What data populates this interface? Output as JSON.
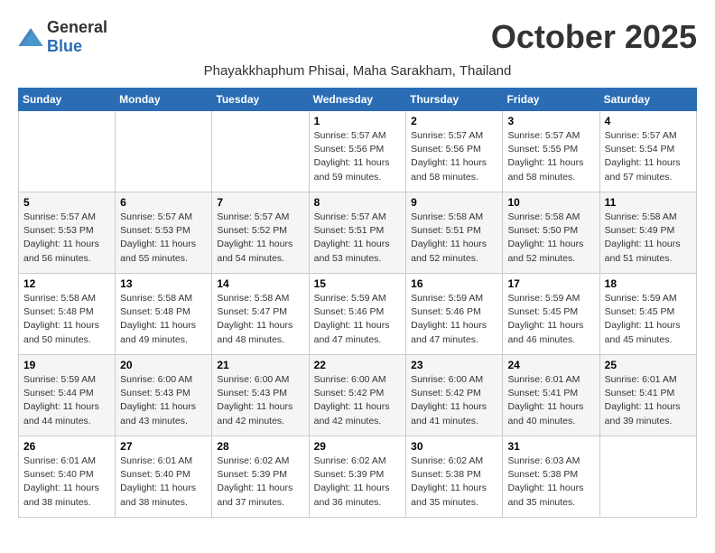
{
  "header": {
    "logo_general": "General",
    "logo_blue": "Blue",
    "month_title": "October 2025",
    "subtitle": "Phayakkhaphum Phisai, Maha Sarakham, Thailand"
  },
  "days_of_week": [
    "Sunday",
    "Monday",
    "Tuesday",
    "Wednesday",
    "Thursday",
    "Friday",
    "Saturday"
  ],
  "weeks": [
    [
      {
        "day": "",
        "sunrise": "",
        "sunset": "",
        "daylight": ""
      },
      {
        "day": "",
        "sunrise": "",
        "sunset": "",
        "daylight": ""
      },
      {
        "day": "",
        "sunrise": "",
        "sunset": "",
        "daylight": ""
      },
      {
        "day": "1",
        "sunrise": "Sunrise: 5:57 AM",
        "sunset": "Sunset: 5:56 PM",
        "daylight": "Daylight: 11 hours and 59 minutes."
      },
      {
        "day": "2",
        "sunrise": "Sunrise: 5:57 AM",
        "sunset": "Sunset: 5:56 PM",
        "daylight": "Daylight: 11 hours and 58 minutes."
      },
      {
        "day": "3",
        "sunrise": "Sunrise: 5:57 AM",
        "sunset": "Sunset: 5:55 PM",
        "daylight": "Daylight: 11 hours and 58 minutes."
      },
      {
        "day": "4",
        "sunrise": "Sunrise: 5:57 AM",
        "sunset": "Sunset: 5:54 PM",
        "daylight": "Daylight: 11 hours and 57 minutes."
      }
    ],
    [
      {
        "day": "5",
        "sunrise": "Sunrise: 5:57 AM",
        "sunset": "Sunset: 5:53 PM",
        "daylight": "Daylight: 11 hours and 56 minutes."
      },
      {
        "day": "6",
        "sunrise": "Sunrise: 5:57 AM",
        "sunset": "Sunset: 5:53 PM",
        "daylight": "Daylight: 11 hours and 55 minutes."
      },
      {
        "day": "7",
        "sunrise": "Sunrise: 5:57 AM",
        "sunset": "Sunset: 5:52 PM",
        "daylight": "Daylight: 11 hours and 54 minutes."
      },
      {
        "day": "8",
        "sunrise": "Sunrise: 5:57 AM",
        "sunset": "Sunset: 5:51 PM",
        "daylight": "Daylight: 11 hours and 53 minutes."
      },
      {
        "day": "9",
        "sunrise": "Sunrise: 5:58 AM",
        "sunset": "Sunset: 5:51 PM",
        "daylight": "Daylight: 11 hours and 52 minutes."
      },
      {
        "day": "10",
        "sunrise": "Sunrise: 5:58 AM",
        "sunset": "Sunset: 5:50 PM",
        "daylight": "Daylight: 11 hours and 52 minutes."
      },
      {
        "day": "11",
        "sunrise": "Sunrise: 5:58 AM",
        "sunset": "Sunset: 5:49 PM",
        "daylight": "Daylight: 11 hours and 51 minutes."
      }
    ],
    [
      {
        "day": "12",
        "sunrise": "Sunrise: 5:58 AM",
        "sunset": "Sunset: 5:48 PM",
        "daylight": "Daylight: 11 hours and 50 minutes."
      },
      {
        "day": "13",
        "sunrise": "Sunrise: 5:58 AM",
        "sunset": "Sunset: 5:48 PM",
        "daylight": "Daylight: 11 hours and 49 minutes."
      },
      {
        "day": "14",
        "sunrise": "Sunrise: 5:58 AM",
        "sunset": "Sunset: 5:47 PM",
        "daylight": "Daylight: 11 hours and 48 minutes."
      },
      {
        "day": "15",
        "sunrise": "Sunrise: 5:59 AM",
        "sunset": "Sunset: 5:46 PM",
        "daylight": "Daylight: 11 hours and 47 minutes."
      },
      {
        "day": "16",
        "sunrise": "Sunrise: 5:59 AM",
        "sunset": "Sunset: 5:46 PM",
        "daylight": "Daylight: 11 hours and 47 minutes."
      },
      {
        "day": "17",
        "sunrise": "Sunrise: 5:59 AM",
        "sunset": "Sunset: 5:45 PM",
        "daylight": "Daylight: 11 hours and 46 minutes."
      },
      {
        "day": "18",
        "sunrise": "Sunrise: 5:59 AM",
        "sunset": "Sunset: 5:45 PM",
        "daylight": "Daylight: 11 hours and 45 minutes."
      }
    ],
    [
      {
        "day": "19",
        "sunrise": "Sunrise: 5:59 AM",
        "sunset": "Sunset: 5:44 PM",
        "daylight": "Daylight: 11 hours and 44 minutes."
      },
      {
        "day": "20",
        "sunrise": "Sunrise: 6:00 AM",
        "sunset": "Sunset: 5:43 PM",
        "daylight": "Daylight: 11 hours and 43 minutes."
      },
      {
        "day": "21",
        "sunrise": "Sunrise: 6:00 AM",
        "sunset": "Sunset: 5:43 PM",
        "daylight": "Daylight: 11 hours and 42 minutes."
      },
      {
        "day": "22",
        "sunrise": "Sunrise: 6:00 AM",
        "sunset": "Sunset: 5:42 PM",
        "daylight": "Daylight: 11 hours and 42 minutes."
      },
      {
        "day": "23",
        "sunrise": "Sunrise: 6:00 AM",
        "sunset": "Sunset: 5:42 PM",
        "daylight": "Daylight: 11 hours and 41 minutes."
      },
      {
        "day": "24",
        "sunrise": "Sunrise: 6:01 AM",
        "sunset": "Sunset: 5:41 PM",
        "daylight": "Daylight: 11 hours and 40 minutes."
      },
      {
        "day": "25",
        "sunrise": "Sunrise: 6:01 AM",
        "sunset": "Sunset: 5:41 PM",
        "daylight": "Daylight: 11 hours and 39 minutes."
      }
    ],
    [
      {
        "day": "26",
        "sunrise": "Sunrise: 6:01 AM",
        "sunset": "Sunset: 5:40 PM",
        "daylight": "Daylight: 11 hours and 38 minutes."
      },
      {
        "day": "27",
        "sunrise": "Sunrise: 6:01 AM",
        "sunset": "Sunset: 5:40 PM",
        "daylight": "Daylight: 11 hours and 38 minutes."
      },
      {
        "day": "28",
        "sunrise": "Sunrise: 6:02 AM",
        "sunset": "Sunset: 5:39 PM",
        "daylight": "Daylight: 11 hours and 37 minutes."
      },
      {
        "day": "29",
        "sunrise": "Sunrise: 6:02 AM",
        "sunset": "Sunset: 5:39 PM",
        "daylight": "Daylight: 11 hours and 36 minutes."
      },
      {
        "day": "30",
        "sunrise": "Sunrise: 6:02 AM",
        "sunset": "Sunset: 5:38 PM",
        "daylight": "Daylight: 11 hours and 35 minutes."
      },
      {
        "day": "31",
        "sunrise": "Sunrise: 6:03 AM",
        "sunset": "Sunset: 5:38 PM",
        "daylight": "Daylight: 11 hours and 35 minutes."
      },
      {
        "day": "",
        "sunrise": "",
        "sunset": "",
        "daylight": ""
      }
    ]
  ]
}
